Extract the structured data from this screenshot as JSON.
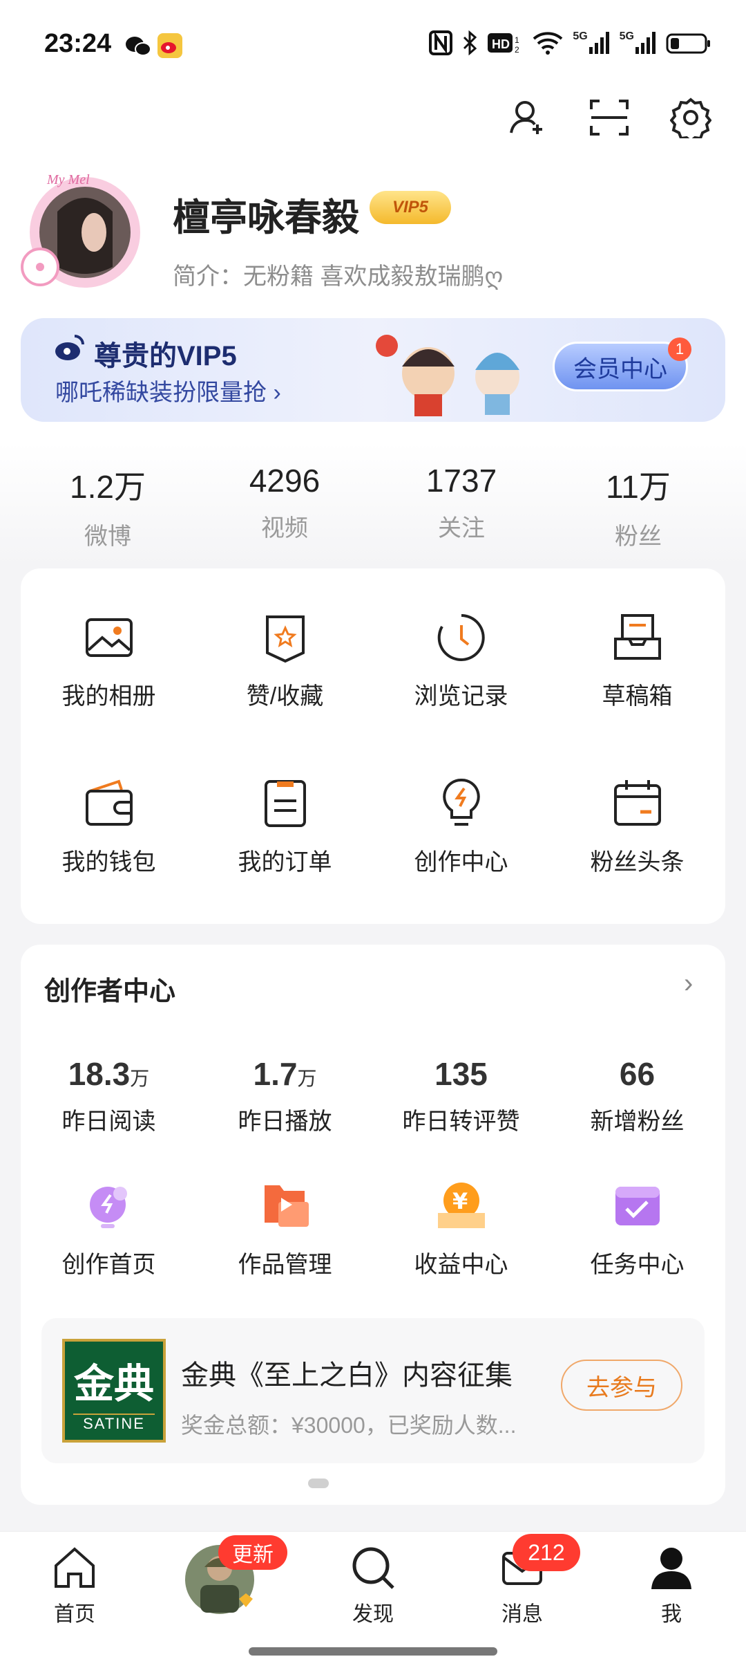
{
  "status_bar": {
    "time": "23:24",
    "signal_labels": [
      "5G",
      "5G"
    ]
  },
  "profile": {
    "name": "檀亭咏春毅",
    "vip_badge": "VIP5",
    "bio": "简介：无粉籍 喜欢成毅敖瑞鹏ღ",
    "avatar_caption": "My Mel"
  },
  "vip_banner": {
    "title": "尊贵的VIP5",
    "subtitle": "哪吒稀缺装扮限量抢 ›",
    "button": "会员中心",
    "badge": "1"
  },
  "stats": [
    {
      "value": "1.2万",
      "label": "微博"
    },
    {
      "value": "4296",
      "label": "视频"
    },
    {
      "value": "1737",
      "label": "关注"
    },
    {
      "value": "11万",
      "label": "粉丝"
    }
  ],
  "menu_grid": [
    {
      "label": "我的相册",
      "icon": "photo-album-icon"
    },
    {
      "label": "赞/收藏",
      "icon": "favorites-icon"
    },
    {
      "label": "浏览记录",
      "icon": "history-icon"
    },
    {
      "label": "草稿箱",
      "icon": "drafts-icon"
    },
    {
      "label": "我的钱包",
      "icon": "wallet-icon"
    },
    {
      "label": "我的订单",
      "icon": "orders-icon"
    },
    {
      "label": "创作中心",
      "icon": "lightbulb-icon"
    },
    {
      "label": "粉丝头条",
      "icon": "calendar-icon"
    }
  ],
  "creator_center": {
    "title": "创作者中心",
    "stats": [
      {
        "value": "18.3",
        "unit": "万",
        "label": "昨日阅读"
      },
      {
        "value": "1.7",
        "unit": "万",
        "label": "昨日播放"
      },
      {
        "value": "135",
        "unit": "",
        "label": "昨日转评赞"
      },
      {
        "value": "66",
        "unit": "",
        "label": "新增粉丝"
      }
    ],
    "tools": [
      {
        "label": "创作首页",
        "icon": "creation-home-icon"
      },
      {
        "label": "作品管理",
        "icon": "works-folder-icon"
      },
      {
        "label": "收益中心",
        "icon": "earnings-icon"
      },
      {
        "label": "任务中心",
        "icon": "tasks-calendar-icon"
      }
    ],
    "promo": {
      "logo_text": "金典",
      "logo_sub": "SATINE",
      "title": "金典《至上之白》内容征集",
      "subtitle": "奖金总额：¥30000，已奖励人数...",
      "button": "去参与"
    }
  },
  "tab_bar": [
    {
      "label": "首页",
      "icon": "home-icon"
    },
    {
      "label": "",
      "icon": "avatar-tab-icon",
      "badge": "更新"
    },
    {
      "label": "发现",
      "icon": "search-icon"
    },
    {
      "label": "消息",
      "icon": "message-icon",
      "badge": "212"
    },
    {
      "label": "我",
      "icon": "profile-icon"
    }
  ],
  "colors": {
    "accent": "#f07b1f",
    "vip_blue": "#1d2d70",
    "badge_red": "#ff3b30"
  }
}
